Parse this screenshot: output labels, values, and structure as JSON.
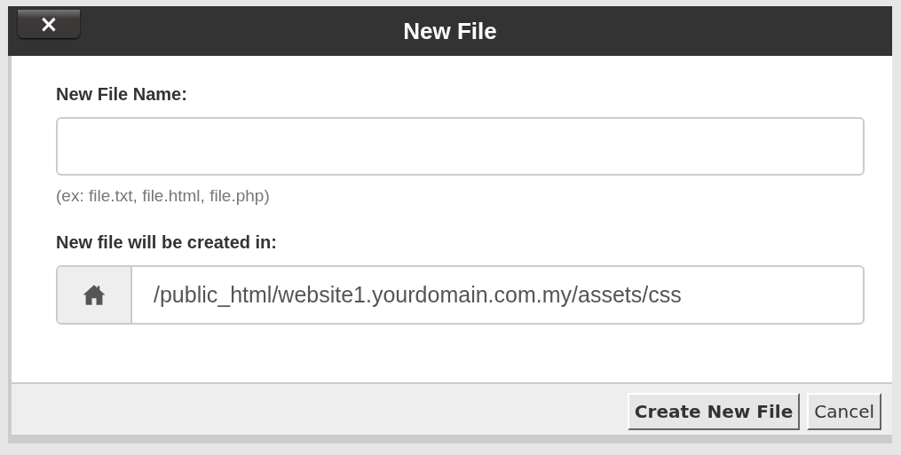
{
  "dialog": {
    "title": "New File",
    "close_label": "×",
    "name_field": {
      "label": "New File Name:",
      "hint": "(ex: file.txt, file.html, file.php)"
    },
    "location": {
      "label": "New file will be created in:",
      "path": "/public_html/website1.yourdomain.com.my/assets/css"
    },
    "buttons": [
      {
        "label": "Create New File",
        "kind": "primary"
      },
      {
        "label": "Cancel",
        "kind": "secondary"
      }
    ]
  }
}
